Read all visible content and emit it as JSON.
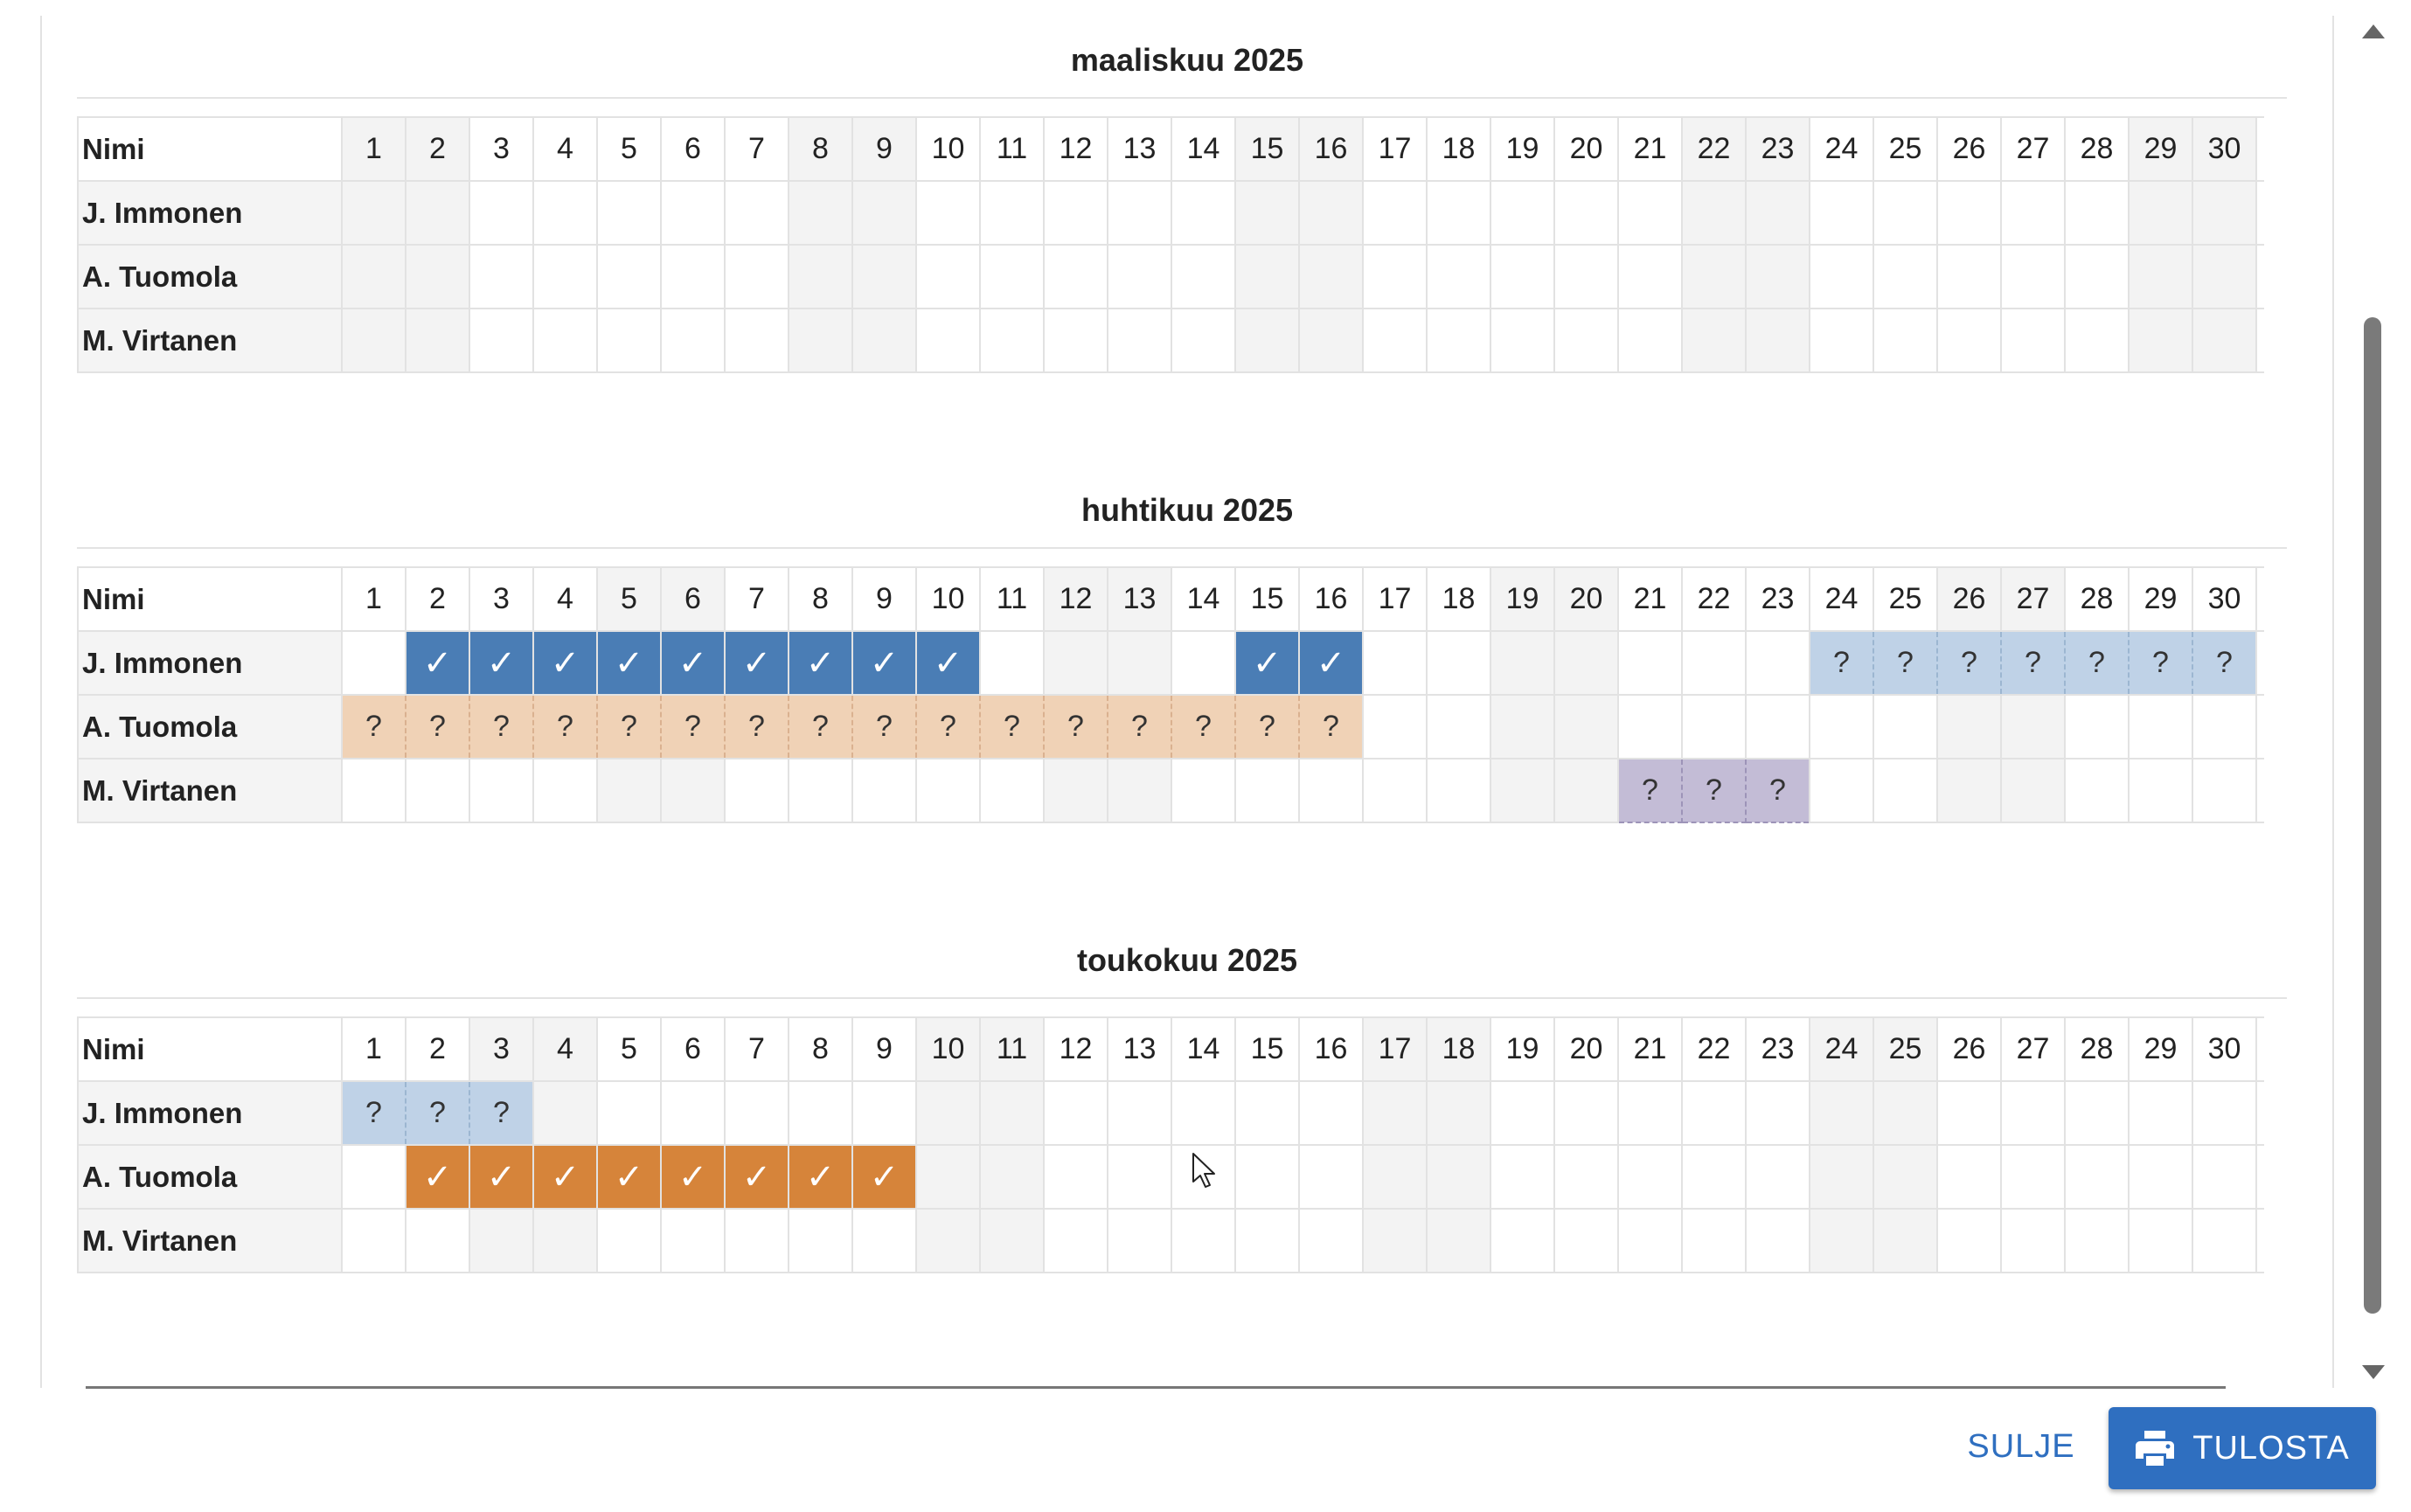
{
  "header_label": "Nimi",
  "months": [
    {
      "title": "maaliskuu 2025",
      "weekend_days": [
        1,
        2,
        8,
        9,
        15,
        16,
        22,
        23,
        29,
        30
      ],
      "rows": [
        {
          "name": "J. Immonen",
          "marks": {}
        },
        {
          "name": "A. Tuomola",
          "marks": {}
        },
        {
          "name": "M. Virtanen",
          "marks": {}
        }
      ]
    },
    {
      "title": "huhtikuu 2025",
      "weekend_days": [
        5,
        6,
        12,
        13,
        19,
        20,
        26,
        27
      ],
      "rows": [
        {
          "name": "J. Immonen",
          "marks": {
            "2": "A",
            "3": "A",
            "4": "A",
            "5": "A",
            "6": "A",
            "7": "A",
            "8": "A",
            "9": "A",
            "10": "A",
            "15": "A",
            "16": "A",
            "24": "C",
            "25": "C",
            "26": "C",
            "27": "C",
            "28": "C",
            "29": "C",
            "30": "C"
          }
        },
        {
          "name": "A. Tuomola",
          "marks": {
            "1": "D",
            "2": "D",
            "3": "D",
            "4": "D",
            "5": "D",
            "6": "D",
            "7": "D",
            "8": "D",
            "9": "D",
            "10": "D",
            "11": "D",
            "12": "D",
            "13": "D",
            "14": "D",
            "15": "D",
            "16": "D"
          }
        },
        {
          "name": "M. Virtanen",
          "marks": {
            "21": "E",
            "22": "E",
            "23": "E"
          }
        }
      ]
    },
    {
      "title": "toukokuu 2025",
      "weekend_days": [
        3,
        4,
        10,
        11,
        17,
        18,
        24,
        25
      ],
      "rows": [
        {
          "name": "J. Immonen",
          "marks": {
            "1": "C",
            "2": "C",
            "3": "C"
          }
        },
        {
          "name": "A. Tuomola",
          "marks": {
            "2": "B",
            "3": "B",
            "4": "B",
            "5": "B",
            "6": "B",
            "7": "B",
            "8": "B",
            "9": "B"
          }
        },
        {
          "name": "M. Virtanen",
          "marks": {}
        }
      ]
    }
  ],
  "mark_styles": {
    "A": {
      "glyph": "✓",
      "color": "#4a7db5",
      "text_color": "#ffffff",
      "kind": "confirmed"
    },
    "B": {
      "glyph": "✓",
      "color": "#d6843a",
      "text_color": "#ffffff",
      "kind": "confirmed"
    },
    "C": {
      "glyph": "?",
      "color": "#bfd2e7",
      "text_color": "#333333",
      "kind": "tentative"
    },
    "D": {
      "glyph": "?",
      "color": "#f0d2b6",
      "text_color": "#333333",
      "kind": "tentative"
    },
    "E": {
      "glyph": "?",
      "color": "#c3bcd6",
      "text_color": "#333333",
      "kind": "tentative"
    }
  },
  "weekend_color": "#f3f3f3",
  "footer": {
    "close_label": "SULJE",
    "print_label": "TULOSTA",
    "print_icon": "printer-icon",
    "accent_color": "#2f6fc0"
  }
}
